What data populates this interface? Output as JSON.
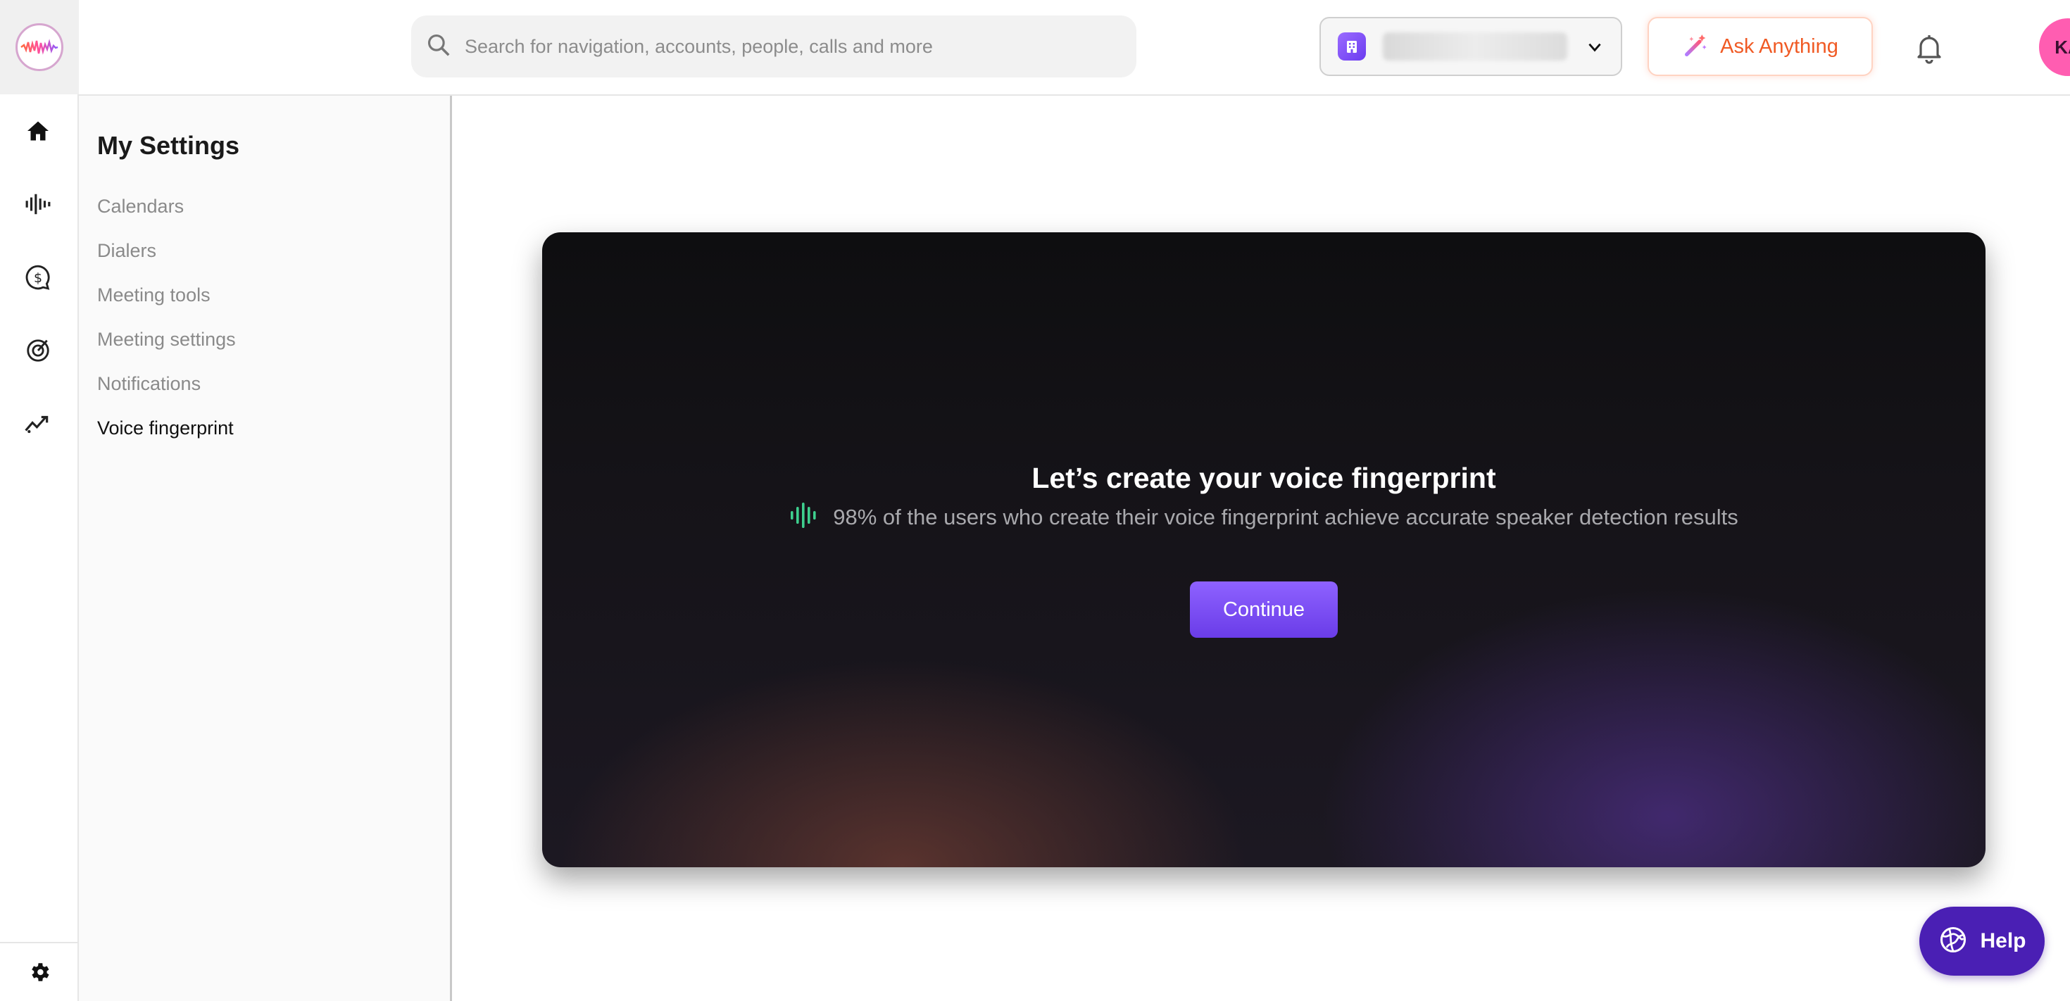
{
  "topbar": {
    "search_placeholder": "Search for navigation, accounts, people, calls and more",
    "ask_label": "Ask Anything",
    "avatar_initials": "KA"
  },
  "rail": {
    "items": [
      {
        "icon": "home-icon"
      },
      {
        "icon": "waveform-icon"
      },
      {
        "icon": "deals-icon"
      },
      {
        "icon": "target-icon"
      },
      {
        "icon": "trend-icon"
      }
    ],
    "bottom_icon": "settings-gear-icon"
  },
  "settings": {
    "title": "My Settings",
    "items": [
      {
        "label": "Calendars",
        "active": false
      },
      {
        "label": "Dialers",
        "active": false
      },
      {
        "label": "Meeting tools",
        "active": false
      },
      {
        "label": "Meeting settings",
        "active": false
      },
      {
        "label": "Notifications",
        "active": false
      },
      {
        "label": "Voice fingerprint",
        "active": true
      }
    ]
  },
  "card": {
    "title": "Let’s create your voice fingerprint",
    "subtitle": "98% of the users who create their voice fingerprint achieve accurate speaker detection results",
    "button_label": "Continue"
  },
  "help": {
    "label": "Help"
  },
  "colors": {
    "accent_purple": "#6a3ce8",
    "ask_orange": "#f05a24",
    "avatar_pink": "#ff5db1",
    "help_purple": "#4a1fb4",
    "waveform_green": "#3ecf8e"
  }
}
